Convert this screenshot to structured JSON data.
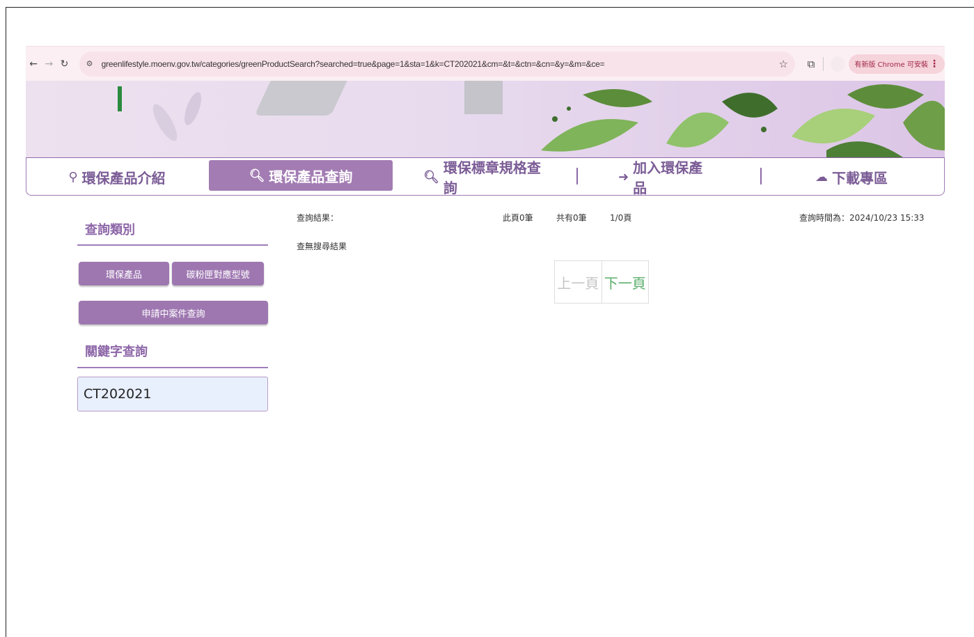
{
  "browser": {
    "url": "greenlifestyle.moenv.gov.tw/categories/greenProductSearch?searched=true&page=1&sta=1&k=CT202021&cm=&t=&ctn=&cn=&y=&m=&ce=",
    "update_label": "有新版 Chrome 可安裝"
  },
  "nav": {
    "intro": "環保產品介紹",
    "product_search": "環保產品查詢",
    "spec_search": "環保標章規格查詢",
    "join": "加入環保產品",
    "download": "下載專區"
  },
  "sidebar": {
    "category_title": "查詢類別",
    "btn_products": "環保產品",
    "btn_cartridge": "碳粉匣對應型號",
    "btn_pending": "申請中案件查詢",
    "keyword_title": "關鍵字查詢",
    "keyword_value": "CT202021"
  },
  "results": {
    "label": "查詢結果：",
    "page_count": "此頁0筆",
    "total": "共有0筆",
    "pages": "1/0頁",
    "query_time": "查詢時間為：2024/10/23 15:33",
    "empty": "查無搜尋結果",
    "prev": "上一頁",
    "next": "下一頁"
  }
}
